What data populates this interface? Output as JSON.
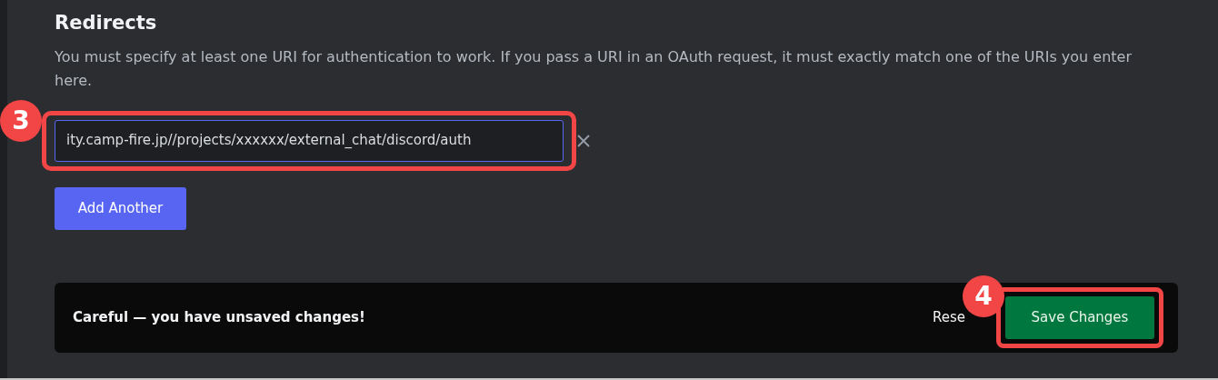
{
  "section": {
    "title": "Redirects",
    "description": "You must specify at least one URI for authentication to work. If you pass a URI in an OAuth request, it must exactly match one of the URIs you enter here."
  },
  "redirects": [
    {
      "value": "ity.camp-fire.jp//projects/xxxxxx/external_chat/discord/auth",
      "focused": true,
      "annotation": "3"
    }
  ],
  "add_button": "Add Another",
  "unsaved_bar": {
    "message": "Careful — you have unsaved changes!",
    "reset": "Rese",
    "save": "Save Changes",
    "annotation": "4"
  }
}
